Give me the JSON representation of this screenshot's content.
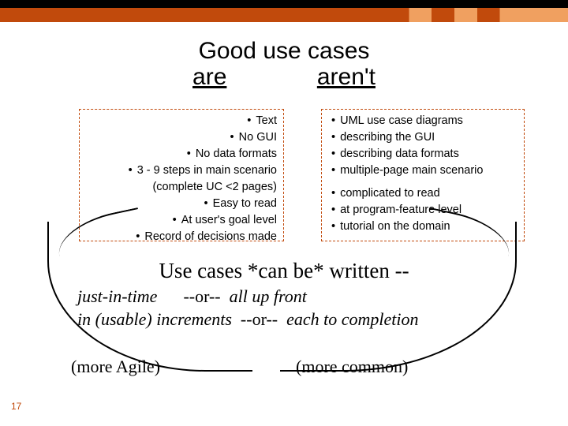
{
  "header": {
    "title": "Good use cases",
    "sub_are": "are",
    "sub_arent": "aren't"
  },
  "left_box": {
    "items": [
      "Text",
      "No GUI",
      "No data formats",
      "3 - 9 steps in main scenario (complete UC <2 pages)",
      "Easy to read",
      "At user's goal level",
      "Record of decisions made"
    ]
  },
  "right_box": {
    "group1": [
      "UML use case diagrams",
      "describing the GUI",
      "describing data formats",
      "multiple-page main scenario"
    ],
    "group2": [
      "complicated to read",
      "at program-feature level",
      "tutorial on the domain"
    ]
  },
  "mid": "Use cases *can be* written --",
  "options": {
    "l1a": "just-in-time",
    "or": "--or--",
    "l1b": "all up front",
    "l2a": "in (usable) increments",
    "l2b": "each to completion"
  },
  "more_agile": "(more Agile)",
  "more_common": "(more common)",
  "page": "17"
}
